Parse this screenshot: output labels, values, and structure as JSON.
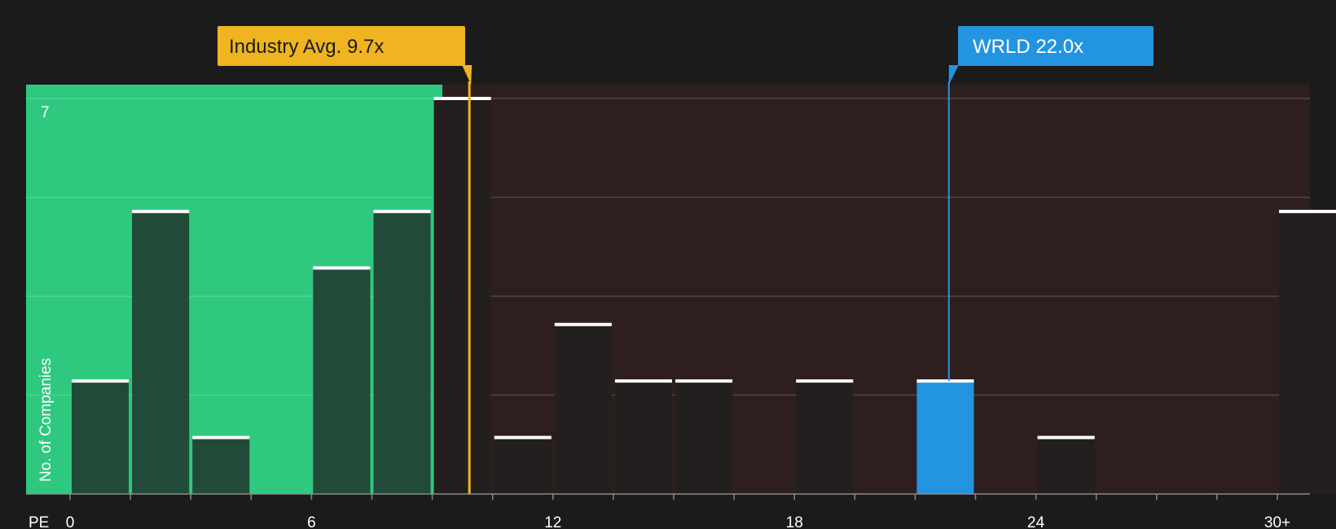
{
  "chart_data": {
    "type": "bar",
    "xlabel": "PE",
    "ylabel": "No. of Companies",
    "x_ticks": [
      "0",
      "6",
      "12",
      "18",
      "24",
      "30+"
    ],
    "y_ticks": [
      "7"
    ],
    "ylim": [
      0,
      7
    ],
    "xlim": [
      0,
      30.75
    ],
    "bin_width": 1.5,
    "bins": [
      {
        "x": 0.0,
        "value": 2
      },
      {
        "x": 1.5,
        "value": 5
      },
      {
        "x": 3.0,
        "value": 1
      },
      {
        "x": 4.5,
        "value": 0
      },
      {
        "x": 6.0,
        "value": 4
      },
      {
        "x": 7.5,
        "value": 5
      },
      {
        "x": 9.0,
        "value": 7
      },
      {
        "x": 10.5,
        "value": 1
      },
      {
        "x": 12.0,
        "value": 3
      },
      {
        "x": 13.5,
        "value": 2
      },
      {
        "x": 15.0,
        "value": 2
      },
      {
        "x": 16.5,
        "value": 0
      },
      {
        "x": 18.0,
        "value": 2
      },
      {
        "x": 19.5,
        "value": 0
      },
      {
        "x": 21.0,
        "value": 2,
        "highlight": true
      },
      {
        "x": 22.5,
        "value": 0
      },
      {
        "x": 24.0,
        "value": 1
      },
      {
        "x": 25.5,
        "value": 0
      },
      {
        "x": 27.0,
        "value": 0
      },
      {
        "x": 28.5,
        "value": 0
      },
      {
        "x": 30.0,
        "value": 5
      }
    ],
    "industry_avg": {
      "label": "Industry Avg. 9.7x",
      "value": 9.7
    },
    "company": {
      "label": "WRLD 22.0x",
      "value": 22.0
    },
    "grid": true,
    "colors": {
      "background": "#1b1b1b",
      "fair_zone": "#2ec97f",
      "expensive_zone": "#2e1e1e",
      "bar_fair": "#224a38",
      "bar_expensive": "#231f1f",
      "highlight_bar": "#2394e0",
      "industry_callout": "#efb41f",
      "company_callout": "#2394e0",
      "bar_cap": "#ffffff",
      "text": "#ffffff",
      "industry_text": "#1b1b1b"
    }
  }
}
